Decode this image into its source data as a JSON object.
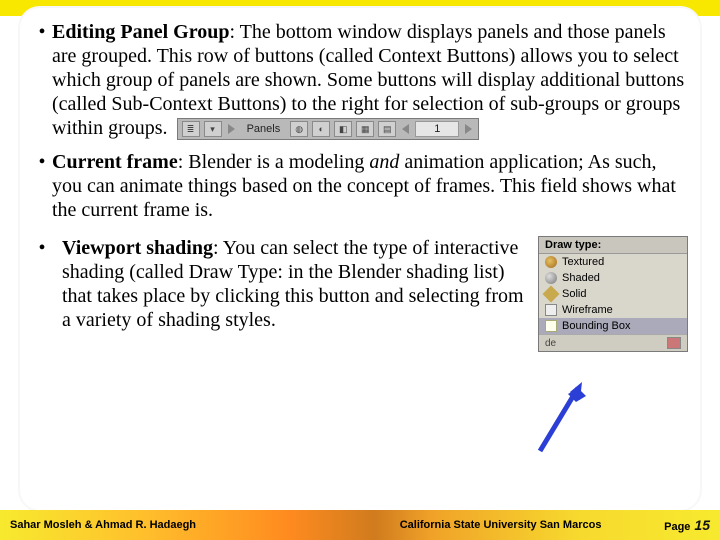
{
  "bullets": {
    "b1": {
      "head": "Editing Panel Group",
      "rest": ": The bottom window displays panels and those panels are grouped. This row of buttons (called Context Buttons) allows you to select which group of panels are shown. Some buttons will display additional buttons (called Sub-Context Buttons) to the right for selection of sub-groups or groups within groups."
    },
    "b2": {
      "head": "Current frame",
      "rest_pre": ": Blender is a modeling ",
      "italic": "and",
      "rest_post": " animation application; As such, you can animate things based on the concept of frames. This field shows what the current frame is."
    },
    "b3": {
      "head": "Viewport shading",
      "rest": ": You can select the type of interactive shading (called Draw Type: in the Blender shading list) that takes place by clicking this button and selecting from a variety of shading styles."
    }
  },
  "panels": {
    "label": "Panels",
    "frame": "1"
  },
  "drawtype": {
    "title": "Draw type:",
    "items": [
      "Textured",
      "Shaded",
      "Solid",
      "Wireframe",
      "Bounding Box"
    ],
    "bottom_left": "de"
  },
  "footer": {
    "left": "Sahar Mosleh & Ahmad R. Hadaegh",
    "mid": "California State University San Marcos",
    "page_label": "Page",
    "page_num": "15"
  }
}
